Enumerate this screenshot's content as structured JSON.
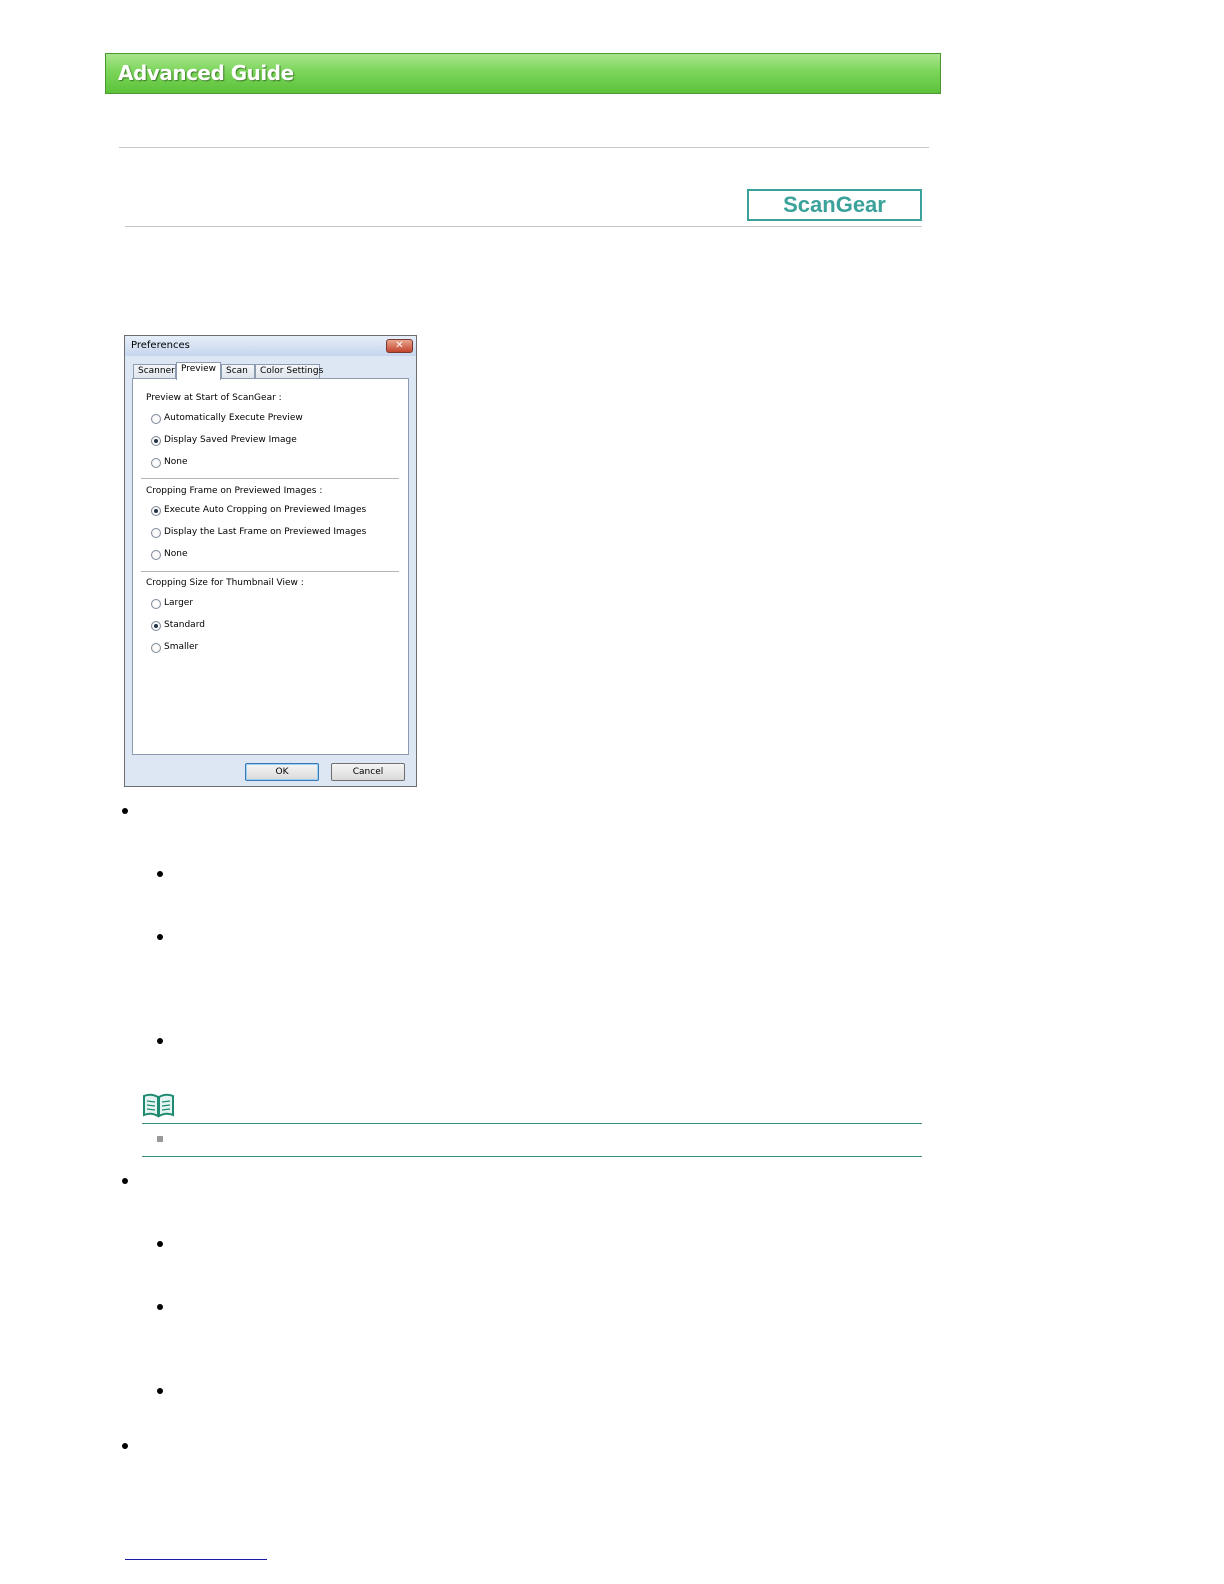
{
  "header": {
    "banner_title": "Advanced Guide",
    "section_badge": "ScanGear"
  },
  "dialog": {
    "title": "Preferences",
    "close_glyph": "✕",
    "tabs": [
      {
        "label": "Scanner",
        "active": false
      },
      {
        "label": "Preview",
        "active": true
      },
      {
        "label": "Scan",
        "active": false
      },
      {
        "label": "Color Settings",
        "active": false
      }
    ],
    "groups": [
      {
        "title": "Preview at Start of ScanGear :",
        "options": [
          {
            "label": "Automatically Execute Preview",
            "selected": false
          },
          {
            "label": "Display Saved Preview Image",
            "selected": true
          },
          {
            "label": "None",
            "selected": false
          }
        ]
      },
      {
        "title": "Cropping Frame on Previewed Images :",
        "options": [
          {
            "label": "Execute Auto Cropping on Previewed Images",
            "selected": true
          },
          {
            "label": "Display the Last Frame on Previewed Images",
            "selected": false
          },
          {
            "label": "None",
            "selected": false
          }
        ]
      },
      {
        "title": "Cropping Size for Thumbnail View :",
        "options": [
          {
            "label": "Larger",
            "selected": false
          },
          {
            "label": "Standard",
            "selected": true
          },
          {
            "label": "Smaller",
            "selected": false
          }
        ]
      }
    ],
    "ok_label": "OK",
    "cancel_label": "Cancel"
  },
  "colors": {
    "banner_green": "#6cc94a",
    "badge_teal": "#3aa29a",
    "note_rule": "#2f8f7c"
  },
  "note": {
    "icon": "note-book-icon"
  }
}
